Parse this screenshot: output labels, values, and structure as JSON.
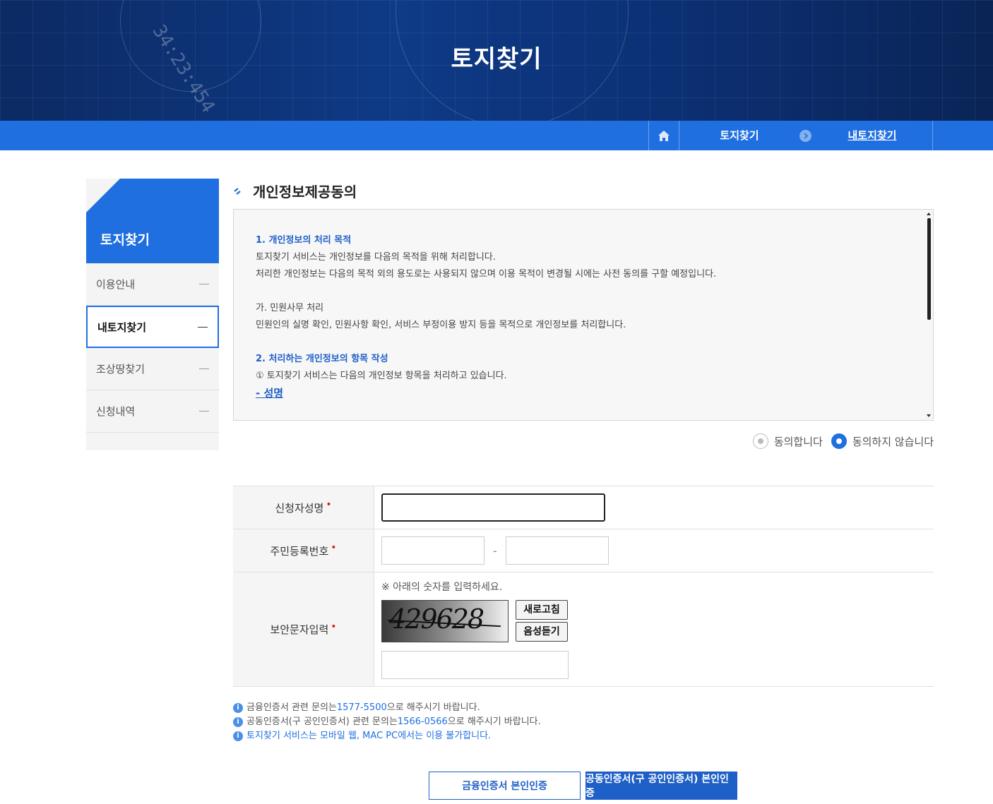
{
  "banner": {
    "title": "토지찾기",
    "decor_number": "34:23:454"
  },
  "breadcrumb": {
    "level1": "토지찾기",
    "level2": "내토지찾기"
  },
  "sidebar": {
    "title": "토지찾기",
    "items": [
      {
        "label": "이용안내",
        "active": false
      },
      {
        "label": "내토지찾기",
        "active": true
      },
      {
        "label": "조상땅찾기",
        "active": false
      },
      {
        "label": "신청내역",
        "active": false
      }
    ]
  },
  "section": {
    "title": "개인정보제공동의"
  },
  "terms": {
    "h1": "1. 개인정보의 처리 목적",
    "p1": "토지찾기 서비스는 개인정보를 다음의 목적을 위해 처리합니다.",
    "p2": "처리한 개인정보는 다음의 목적 외의 용도로는 사용되지 않으며 이용 목적이 변경될 시에는 사전 동의를 구할 예정입니다.",
    "sub1": "가. 민원사무 처리",
    "p3": "민원인의 실명 확인, 민원사항 확인, 서비스 부정이용 방지 등을 목적으로 개인정보를 처리합니다.",
    "h2": "2. 처리하는 개인정보의 항목 작성",
    "p4": "① 토지찾기 서비스는 다음의 개인정보 항목을 처리하고 있습니다.",
    "link": "- 성명"
  },
  "consent": {
    "agree": "동의합니다",
    "disagree": "동의하지 않습니다",
    "selected": "disagree"
  },
  "form": {
    "name_label": "신청자성명",
    "rrn_label": "주민등록번호",
    "rrn_sep": "-",
    "captcha_label": "보안문자입력",
    "captcha_hint": "※ 아래의 숫자를 입력하세요.",
    "captcha_text": "429628",
    "refresh": "새로고침",
    "audio": "음성듣기",
    "required_mark": "•"
  },
  "notes": {
    "n1_pre": "금융인증서 관련 문의는",
    "n1_tel": "1577-5500",
    "n1_post": " 으로 해주시기 바랍니다.",
    "n2_pre": "공동인증서(구 공인인증서) 관련 문의는",
    "n2_tel": "1566-0566",
    "n2_post": " 으로 해주시기 바랍니다.",
    "n3": "토지찾기 서비스는 모바일 웹, MAC PC에서는 이용 불가합니다.",
    "icon": "i"
  },
  "buttons": {
    "financial": "금융인증서 본인인증",
    "joint": "공동인증서(구 공인인증서) 본인인증"
  },
  "colors": {
    "primary": "#1f6fe0",
    "banner": "#0e3a86",
    "required": "#e02020"
  }
}
